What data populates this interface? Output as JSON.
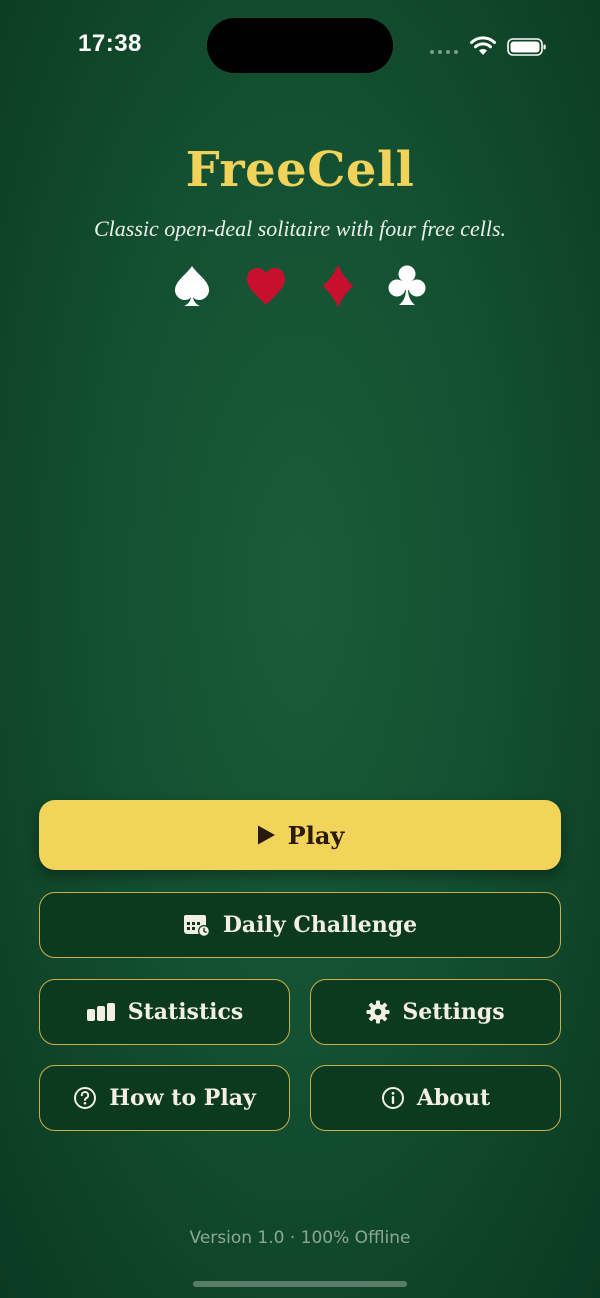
{
  "status_bar": {
    "time": "17:38"
  },
  "header": {
    "title": "FreeCell",
    "subtitle": "Classic open-deal solitaire with four free cells."
  },
  "suits": [
    {
      "name": "spade",
      "color": "#ffffff"
    },
    {
      "name": "heart",
      "color": "#c8102e"
    },
    {
      "name": "diamond",
      "color": "#c8102e"
    },
    {
      "name": "club",
      "color": "#ffffff"
    }
  ],
  "menu": {
    "play_label": "Play",
    "daily_label": "Daily Challenge",
    "stats_label": "Statistics",
    "settings_label": "Settings",
    "howto_label": "How to Play",
    "about_label": "About"
  },
  "footer": {
    "version_text": "Version 1.0 · 100% Offline"
  },
  "colors": {
    "accent": "#f3d45a",
    "background": "#145032",
    "button_border": "#c9b04e"
  }
}
